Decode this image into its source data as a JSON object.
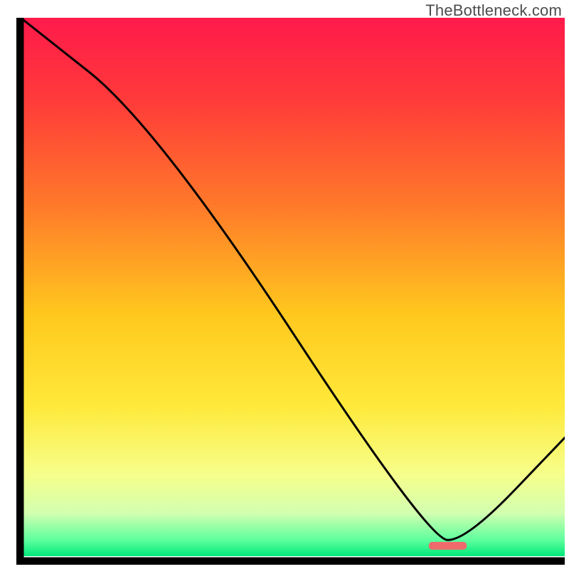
{
  "watermark": "TheBottleneck.com",
  "chart_data": {
    "type": "line",
    "title": "",
    "xlabel": "",
    "ylabel": "",
    "xlim": [
      0,
      100
    ],
    "ylim": [
      0,
      100
    ],
    "grid": false,
    "legend": false,
    "series": [
      {
        "name": "curve",
        "x": [
          0,
          25,
          75,
          82,
          100
        ],
        "values": [
          100,
          80,
          3,
          3,
          22
        ],
        "notes": "Piecewise curve reading (y%) off the vertical gradient: starts top-left at ~100%, shallow slope to ~80% at x≈25, steep linear drop to ~3% near x≈75, flat valley 75–82, rises to ~22% at right edge."
      }
    ],
    "valley_marker": {
      "x_start": 75,
      "x_end": 82,
      "y": 2,
      "color": "#ef6b6b"
    },
    "background_gradient": {
      "stops": [
        {
          "offset": 0.0,
          "color": "#ff1a4b"
        },
        {
          "offset": 0.15,
          "color": "#ff3a3a"
        },
        {
          "offset": 0.35,
          "color": "#ff7a2a"
        },
        {
          "offset": 0.55,
          "color": "#ffc81e"
        },
        {
          "offset": 0.72,
          "color": "#ffe93a"
        },
        {
          "offset": 0.85,
          "color": "#f6ff8c"
        },
        {
          "offset": 0.92,
          "color": "#d2ffb0"
        },
        {
          "offset": 0.97,
          "color": "#5eff9e"
        },
        {
          "offset": 1.0,
          "color": "#00e87a"
        }
      ]
    },
    "axis_color": "#000000",
    "line_color": "#000000"
  }
}
